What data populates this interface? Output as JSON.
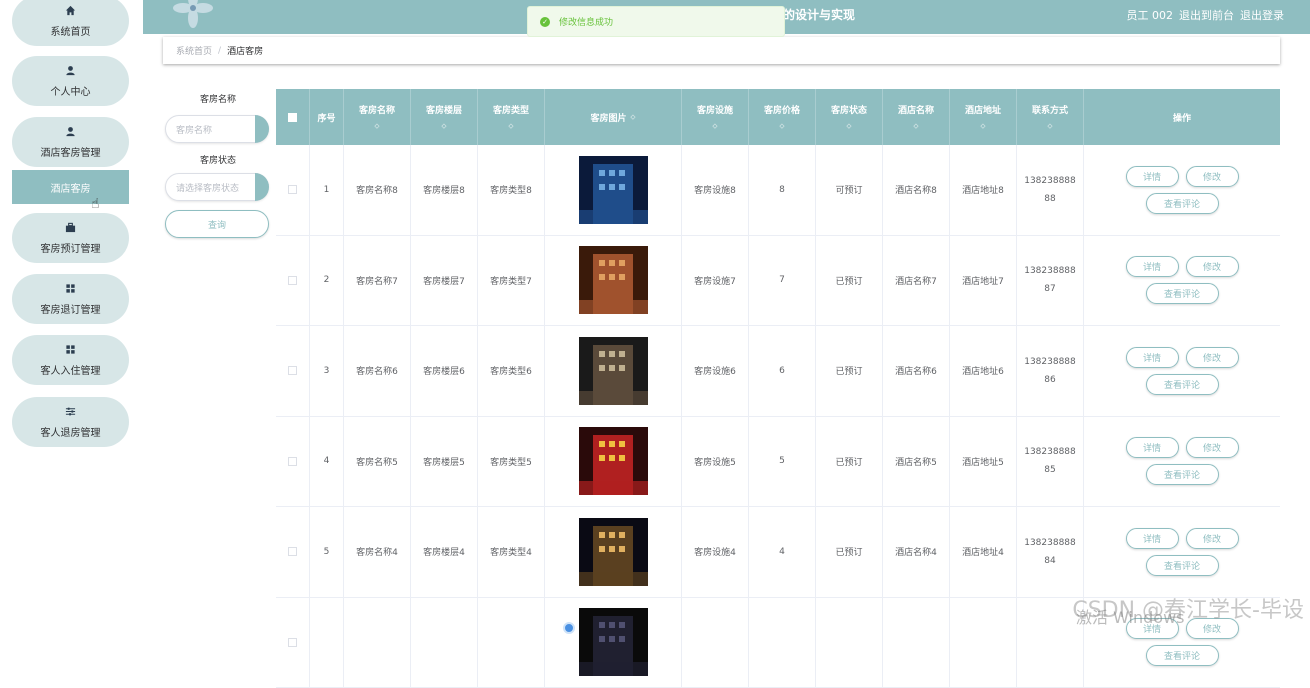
{
  "sidebar": {
    "items": [
      {
        "label": "系统首页",
        "icon": "home-icon"
      },
      {
        "label": "个人中心",
        "icon": "user-icon"
      },
      {
        "label": "酒店客房管理",
        "icon": "user-icon"
      },
      {
        "label": "客房预订管理",
        "icon": "briefcase-icon"
      },
      {
        "label": "客房退订管理",
        "icon": "grid-icon"
      },
      {
        "label": "客人入住管理",
        "icon": "grid-icon"
      },
      {
        "label": "客人退房管理",
        "icon": "sliders-icon"
      }
    ],
    "active_sub": "酒店客房"
  },
  "header": {
    "title_visible": "的设计与实现",
    "user": "员工 002",
    "to_front": "退出到前台",
    "logout": "退出登录"
  },
  "toast": {
    "message": "修改信息成功",
    "color": "#67c23a"
  },
  "breadcrumb": {
    "home": "系统首页",
    "separator": "/",
    "current": "酒店客房"
  },
  "search": {
    "name_label": "客房名称",
    "name_placeholder": "客房名称",
    "status_label": "客房状态",
    "status_placeholder": "请选择客房状态",
    "query_button": "查询"
  },
  "table": {
    "headers": [
      "序号",
      "客房名称",
      "客房楼层",
      "客房类型",
      "客房图片",
      "客房设施",
      "客房价格",
      "客房状态",
      "酒店名称",
      "酒店地址",
      "联系方式",
      "操作"
    ],
    "rows": [
      {
        "index": "1",
        "name": "客房名称8",
        "floor": "客房楼层8",
        "type": "客房类型8",
        "facility": "客房设施8",
        "price": "8",
        "status": "可预订",
        "hotel": "酒店名称8",
        "address": "酒店地址8",
        "phone1": "138238888",
        "phone2": "88"
      },
      {
        "index": "2",
        "name": "客房名称7",
        "floor": "客房楼层7",
        "type": "客房类型7",
        "facility": "客房设施7",
        "price": "7",
        "status": "已预订",
        "hotel": "酒店名称7",
        "address": "酒店地址7",
        "phone1": "138238888",
        "phone2": "87"
      },
      {
        "index": "3",
        "name": "客房名称6",
        "floor": "客房楼层6",
        "type": "客房类型6",
        "facility": "客房设施6",
        "price": "6",
        "status": "已预订",
        "hotel": "酒店名称6",
        "address": "酒店地址6",
        "phone1": "138238888",
        "phone2": "86"
      },
      {
        "index": "4",
        "name": "客房名称5",
        "floor": "客房楼层5",
        "type": "客房类型5",
        "facility": "客房设施5",
        "price": "5",
        "status": "已预订",
        "hotel": "酒店名称5",
        "address": "酒店地址5",
        "phone1": "138238888",
        "phone2": "85"
      },
      {
        "index": "5",
        "name": "客房名称4",
        "floor": "客房楼层4",
        "type": "客房类型4",
        "facility": "客房设施4",
        "price": "4",
        "status": "已预订",
        "hotel": "酒店名称4",
        "address": "酒店地址4",
        "phone1": "138238888",
        "phone2": "84"
      },
      {
        "index": "",
        "name": "",
        "floor": "",
        "type": "",
        "facility": "",
        "price": "",
        "status": "",
        "hotel": "",
        "address": "",
        "phone1": "",
        "phone2": ""
      }
    ],
    "actions": {
      "detail": "详情",
      "edit": "修改",
      "comments": "查看评论"
    }
  },
  "watermark": "CSDN @春江学长-毕设",
  "os_watermark": "激活 Windows",
  "colors": {
    "accent": "#8fbec1",
    "nav_bg": "#d7e6e7",
    "success": "#67c23a"
  }
}
